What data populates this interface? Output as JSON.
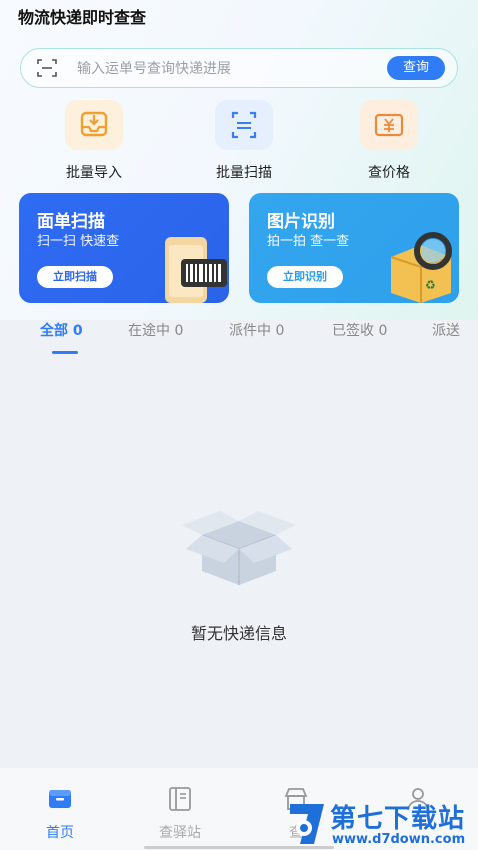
{
  "app": {
    "title": "物流快递即时查查"
  },
  "search": {
    "placeholder": "输入运单号查询快递进展",
    "button": "查询"
  },
  "quick_actions": [
    {
      "label": "批量导入",
      "icon": "inbox-import-icon"
    },
    {
      "label": "批量扫描",
      "icon": "scan-frame-icon"
    },
    {
      "label": "查价格",
      "icon": "price-tag-icon"
    }
  ],
  "cards": [
    {
      "title": "面单扫描",
      "subtitle": "扫一扫 快速查",
      "button": "立即扫描",
      "icon": "barcode-phone-icon"
    },
    {
      "title": "图片识别",
      "subtitle": "拍一拍 查一查",
      "button": "立即识别",
      "icon": "magnifier-package-icon"
    }
  ],
  "tabs": [
    "全部 0",
    "在途中 0",
    "派件中 0",
    "已签收 0",
    "派送"
  ],
  "active_tab": "全部 0",
  "empty_state": {
    "text": "暂无快递信息",
    "icon": "empty-box-icon"
  },
  "bottom_nav": [
    {
      "label": "首页",
      "icon": "home-box-icon",
      "active": true
    },
    {
      "label": "查驿站",
      "icon": "book-icon",
      "active": false
    },
    {
      "label": "查",
      "icon": "store-icon",
      "active": false
    },
    {
      "label": "",
      "icon": "person-icon",
      "active": false
    }
  ],
  "watermark": {
    "text": "第七下载站",
    "url": "www.d7down.com"
  },
  "colors": {
    "accent": "#2f7cf6",
    "card1": "#2a6ef5",
    "card2": "#2fa3ea",
    "search_border": "#a9e3df"
  }
}
